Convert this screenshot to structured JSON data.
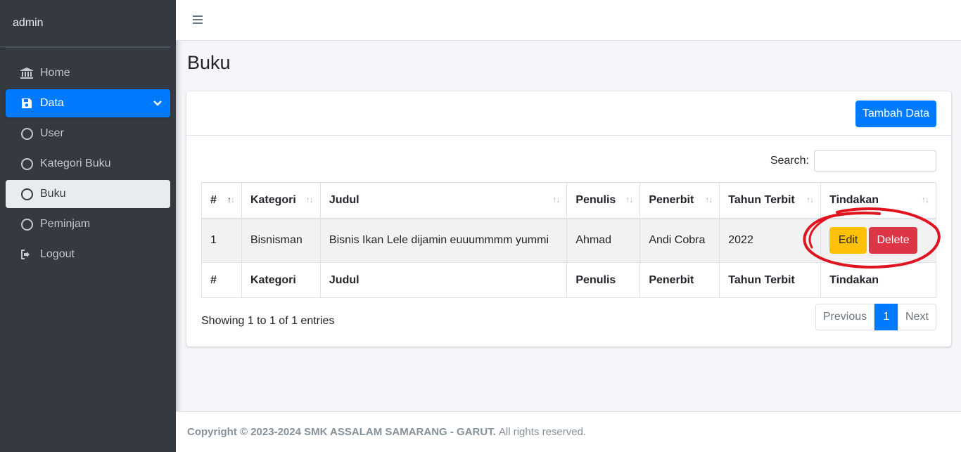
{
  "brand": {
    "name": "admin"
  },
  "sidebar": {
    "items": [
      {
        "label": "Home",
        "icon": "bank-icon"
      },
      {
        "label": "Data",
        "icon": "save-icon"
      },
      {
        "label": "User",
        "icon": "circle-icon"
      },
      {
        "label": "Kategori Buku",
        "icon": "circle-icon"
      },
      {
        "label": "Buku",
        "icon": "circle-icon"
      },
      {
        "label": "Peminjam",
        "icon": "circle-icon"
      },
      {
        "label": "Logout",
        "icon": "sign-out-icon"
      }
    ]
  },
  "page": {
    "title": "Buku"
  },
  "card": {
    "add_button": "Tambah Data",
    "search_label": "Search:",
    "search_value": ""
  },
  "table": {
    "headers": [
      "#",
      "Kategori",
      "Judul",
      "Penulis",
      "Penerbit",
      "Tahun Terbit",
      "Tindakan"
    ],
    "rows": [
      {
        "no": "1",
        "kategori": "Bisnisman",
        "judul": "Bisnis Ikan Lele dijamin euuummmm yummi",
        "penulis": "Ahmad",
        "penerbit": "Andi Cobra",
        "tahun": "2022"
      }
    ],
    "edit_label": "Edit",
    "delete_label": "Delete",
    "footer_headers": [
      "#",
      "Kategori",
      "Judul",
      "Penulis",
      "Penerbit",
      "Tahun Terbit",
      "Tindakan"
    ]
  },
  "pagination": {
    "info": "Showing 1 to 1 of 1 entries",
    "previous": "Previous",
    "current": "1",
    "next": "Next"
  },
  "footer": {
    "copyright": "Copyright © 2023-2024 SMK ASSALAM SAMARANG - GARUT.",
    "rights": "All rights reserved."
  },
  "colors": {
    "primary": "#007bff",
    "warning": "#ffc107",
    "danger": "#dc3545",
    "sidebar": "#343a40",
    "annotation": "#e0141e"
  }
}
